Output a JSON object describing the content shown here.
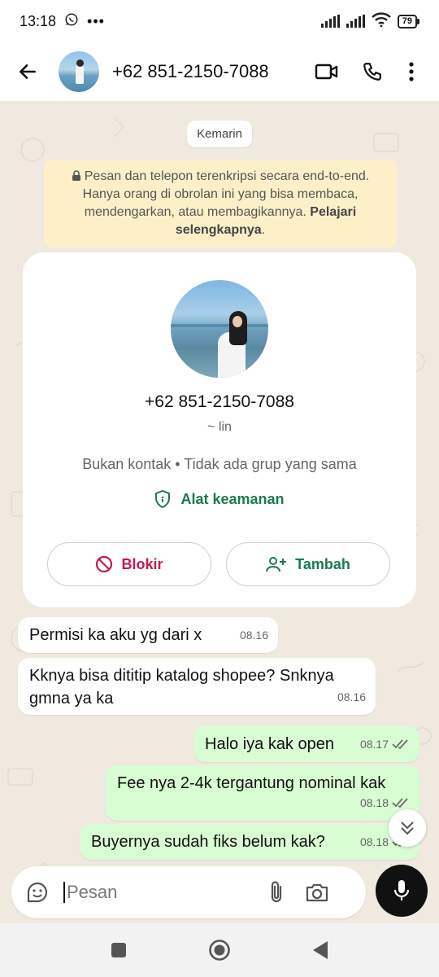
{
  "status_bar": {
    "time": "13:18",
    "battery": "79"
  },
  "header": {
    "title": "+62 851-2150-7088"
  },
  "chat": {
    "date_chip": "Kemarin",
    "encryption_notice": "Pesan dan telepon terenkripsi secara end-to-end. Hanya orang di obrolan ini yang bisa membaca, mendengarkan, atau membagikannya.",
    "encryption_link": "Pelajari selengkapnya",
    "profile_card": {
      "number": "+62 851-2150-7088",
      "alias": "~ lin",
      "info": "Bukan kontak • Tidak ada grup yang sama",
      "security_label": "Alat keamanan",
      "block_label": "Blokir",
      "add_label": "Tambah"
    },
    "messages": [
      {
        "direction": "in",
        "text": "Permisi ka aku yg dari x",
        "time": "08.16"
      },
      {
        "direction": "in",
        "text": "Kknya bisa dititip katalog shopee? Snknya gmna ya ka",
        "time": "08.16"
      },
      {
        "direction": "out",
        "text": "Halo iya kak open",
        "time": "08.17"
      },
      {
        "direction": "out",
        "text": "Fee nya 2-4k tergantung nominal kak",
        "time": "08.18"
      },
      {
        "direction": "out",
        "text": "Buyernya sudah fiks belum kak?",
        "time": "08.18"
      }
    ]
  },
  "composer": {
    "placeholder": "Pesan"
  },
  "colors": {
    "accent_green": "#1b7a4f",
    "block_red": "#c4194b",
    "outgoing_bubble": "#d9fdd3",
    "notice_bg": "#fdf0c9",
    "read_tick_gray": "#6b6b6b"
  },
  "icons": {
    "header": [
      "back-arrow-icon",
      "video-call-icon",
      "phone-icon",
      "more-vert-icon"
    ],
    "composer": [
      "sticker-icon",
      "attach-icon",
      "camera-icon",
      "mic-icon"
    ],
    "nav": [
      "nav-recents-icon",
      "nav-home-icon",
      "nav-back-icon"
    ]
  }
}
